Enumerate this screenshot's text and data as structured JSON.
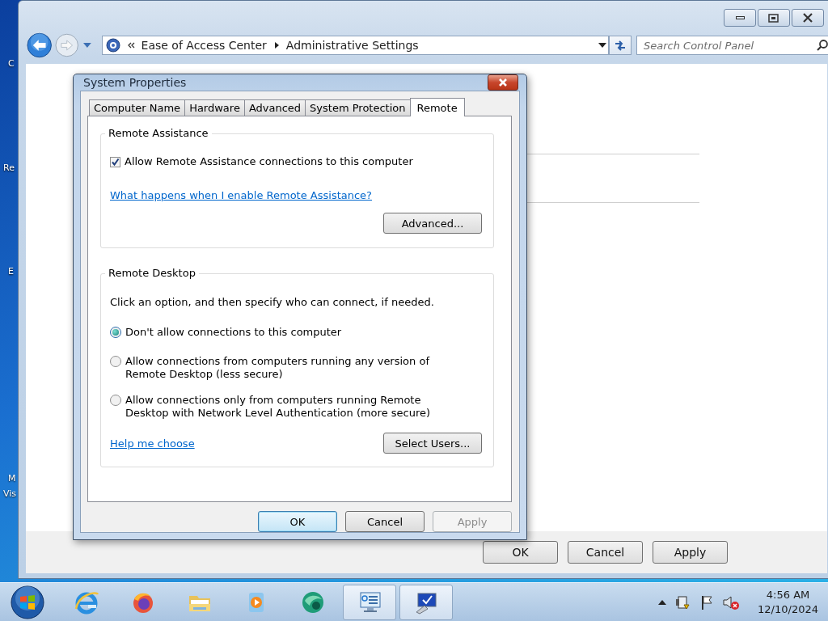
{
  "desktop_icons": [
    {
      "label": "C"
    },
    {
      "label": "Re"
    },
    {
      "label": "E"
    },
    {
      "label": "M"
    },
    {
      "label": "Vis"
    }
  ],
  "control_panel": {
    "breadcrumb": [
      "Ease of Access Center",
      "Administrative Settings"
    ],
    "search": {
      "placeholder": "Search Control Panel"
    },
    "buttons": [
      {
        "label": "OK"
      },
      {
        "label": "Cancel"
      },
      {
        "label": "Apply"
      }
    ]
  },
  "dialog": {
    "title": "System Properties",
    "tabs": [
      {
        "label": "Computer Name",
        "selected": false
      },
      {
        "label": "Hardware",
        "selected": false
      },
      {
        "label": "Advanced",
        "selected": false
      },
      {
        "label": "System Protection",
        "selected": false
      },
      {
        "label": "Remote",
        "selected": true
      }
    ],
    "remote_assistance": {
      "heading": "Remote Assistance",
      "allow": {
        "label": "Allow Remote Assistance connections to this computer",
        "checked": true
      },
      "link": "What happens when I enable Remote Assistance?",
      "button": "Advanced..."
    },
    "remote_desktop": {
      "heading": "Remote Desktop",
      "intro": "Click an option, and then specify who can connect, if needed.",
      "options": [
        {
          "label": "Don't allow connections to this computer",
          "selected": true
        },
        {
          "label": "Allow connections from computers running any version of\nRemote Desktop (less secure)",
          "selected": false
        },
        {
          "label": "Allow connections only from computers running Remote\nDesktop with Network Level Authentication (more secure)",
          "selected": false
        }
      ],
      "link": "Help me choose",
      "button": "Select Users..."
    },
    "buttons": [
      {
        "label": "OK",
        "disabled": false,
        "default": true
      },
      {
        "label": "Cancel",
        "disabled": false,
        "default": false
      },
      {
        "label": "Apply",
        "disabled": true,
        "default": false
      }
    ]
  },
  "taskbar": {
    "apps": [
      {
        "kind": "browser",
        "open": false
      },
      {
        "kind": "firefox",
        "open": false
      },
      {
        "kind": "folder",
        "open": false
      },
      {
        "kind": "media",
        "open": false
      },
      {
        "kind": "globe",
        "open": false
      },
      {
        "kind": "panel",
        "open": true
      },
      {
        "kind": "monitor",
        "open": true
      }
    ],
    "clock": {
      "time": "4:56 AM",
      "date": "12/10/2024"
    }
  }
}
